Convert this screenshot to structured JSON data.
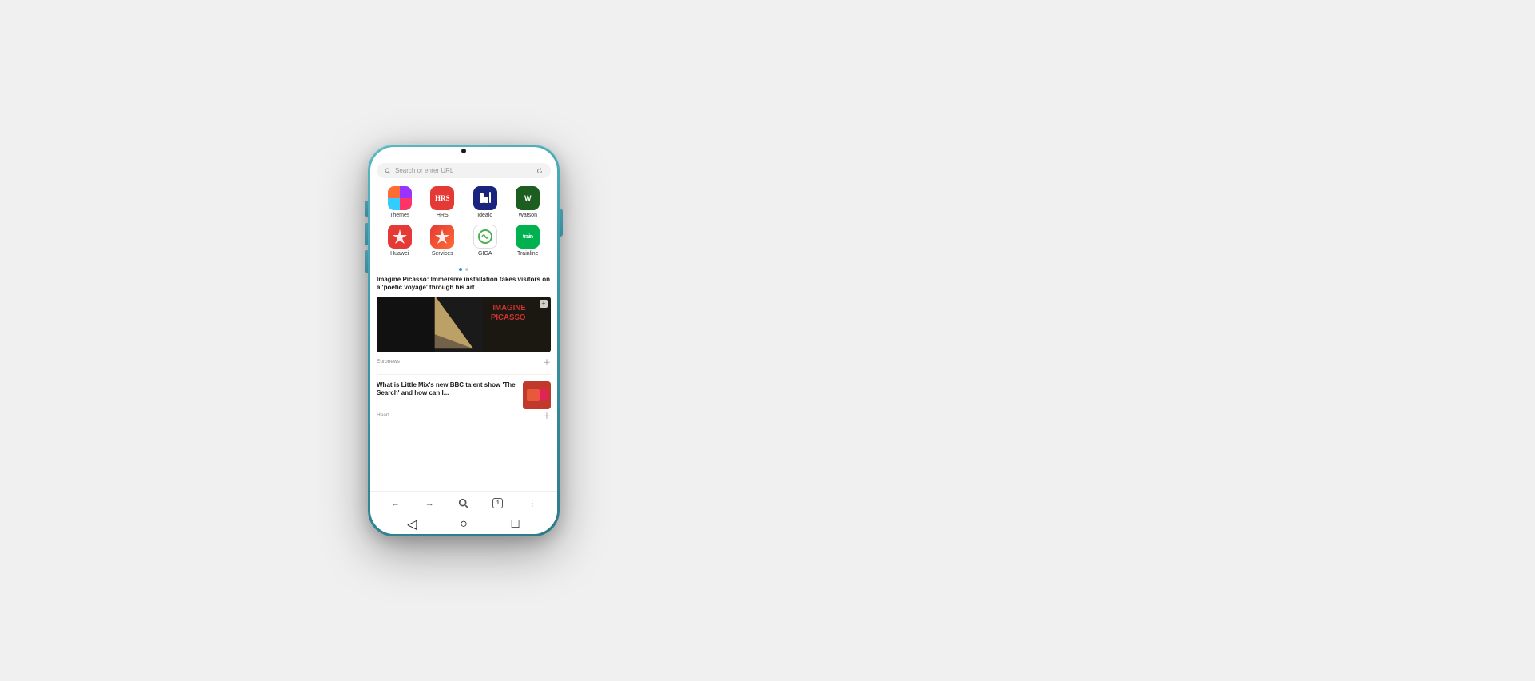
{
  "phone": {
    "search_placeholder": "Search or enter URL",
    "apps_row1": [
      {
        "id": "themes",
        "label": "Themes",
        "icon_class": "icon-themes"
      },
      {
        "id": "hrs",
        "label": "HRS",
        "icon_class": "icon-hrs"
      },
      {
        "id": "idealo",
        "label": "Idealo",
        "icon_class": "icon-idealo"
      },
      {
        "id": "watson",
        "label": "Watson",
        "icon_class": "icon-watson"
      }
    ],
    "apps_row2": [
      {
        "id": "huawei",
        "label": "Huawei",
        "icon_class": "icon-huawei"
      },
      {
        "id": "services",
        "label": "Services",
        "icon_class": "icon-services"
      },
      {
        "id": "giga",
        "label": "GIGA",
        "icon_class": "icon-giga"
      },
      {
        "id": "trainline",
        "label": "Trainline",
        "icon_class": "icon-trainline"
      }
    ],
    "news": [
      {
        "id": "news1",
        "title": "Imagine Picasso: Immersive installation takes visitors on a 'poetic voyage' through his art",
        "source": "Euronews",
        "has_image": true
      },
      {
        "id": "news2",
        "title": "What is Little Mix's new BBC talent show 'The Search' and how can I...",
        "source": "Heart",
        "has_thumb": true
      }
    ],
    "bottom_nav": {
      "back_label": "←",
      "forward_label": "→",
      "search_label": "🔍",
      "tabs_count": "1",
      "menu_label": "⋮"
    },
    "android_nav": {
      "back": "◁",
      "home": "○",
      "recents": "□"
    }
  }
}
